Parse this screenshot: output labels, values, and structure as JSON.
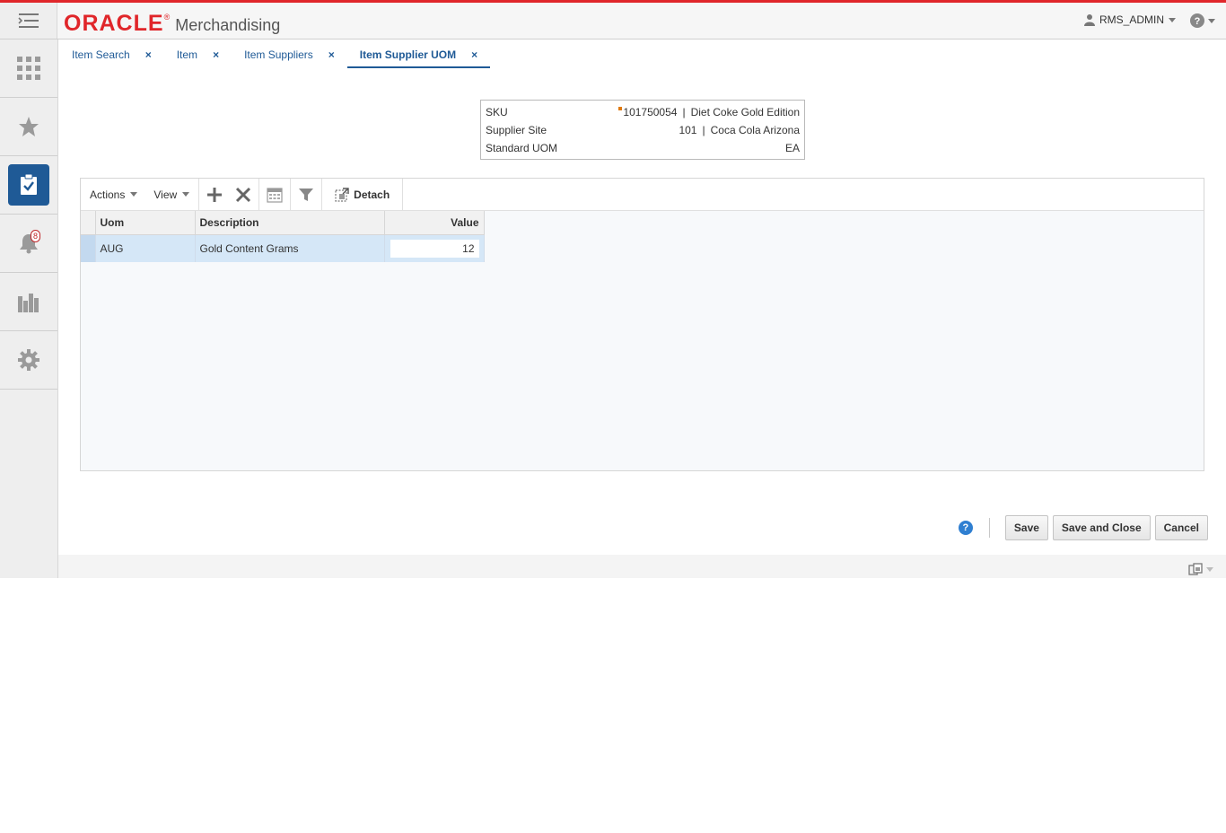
{
  "header": {
    "brand": "ORACLE",
    "brand_mark": "®",
    "app_name": "Merchandising",
    "user": "RMS_ADMIN"
  },
  "sidebar": {
    "items": [
      {
        "icon": "grid-icon"
      },
      {
        "icon": "star-icon"
      },
      {
        "icon": "task-list-icon",
        "active": true
      },
      {
        "icon": "bell-icon",
        "badge": "8"
      },
      {
        "icon": "bar-chart-icon"
      },
      {
        "icon": "gear-icon"
      }
    ]
  },
  "tabs": [
    {
      "label": "Item Search",
      "close": "×"
    },
    {
      "label": "Item",
      "close": "×"
    },
    {
      "label": "Item Suppliers",
      "close": "×"
    },
    {
      "label": "Item Supplier UOM",
      "close": "×",
      "active": true
    }
  ],
  "info": {
    "sku_label": "SKU",
    "sku_number": "101750054",
    "sku_sep": "|",
    "sku_desc": "Diet Coke Gold Edition",
    "site_label": "Supplier Site",
    "site_number": "101",
    "site_sep": "|",
    "site_name": "Coca Cola Arizona",
    "uom_label": "Standard UOM",
    "uom_value": "EA"
  },
  "toolbar": {
    "actions_label": "Actions",
    "view_label": "View",
    "detach_label": "Detach"
  },
  "table": {
    "columns": [
      "Uom",
      "Description",
      "Value"
    ],
    "rows": [
      {
        "uom": "AUG",
        "description": "Gold Content Grams",
        "value": "12"
      }
    ]
  },
  "footer": {
    "help": "?",
    "save_label": "Save",
    "save_close_label": "Save and Close",
    "cancel_label": "Cancel"
  },
  "colors": {
    "accent": "#1f5a96",
    "brand_red": "#e0262a",
    "selected_row": "#d5e7f7"
  }
}
